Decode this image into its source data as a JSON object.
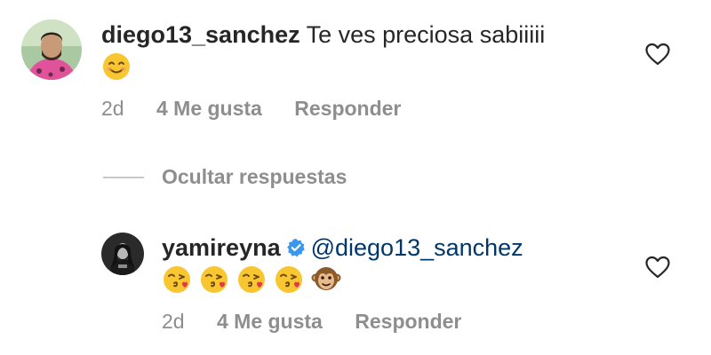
{
  "comment": {
    "username": "diego13_sanchez",
    "text": "Te ves preciosa sabiiiii",
    "emoji": "smiling-face-icon",
    "age": "2d",
    "likes": "4 Me gusta",
    "reply": "Responder"
  },
  "replies_toggle": {
    "label": "Ocultar respuestas"
  },
  "reply": {
    "username": "yamireyna",
    "verified_icon": "verified-badge-icon",
    "mention": "@diego13_sanchez",
    "emojis": [
      "kissing-face-icon",
      "kissing-face-icon",
      "kissing-face-icon",
      "kissing-face-icon",
      "monkey-face-icon"
    ],
    "age": "2d",
    "likes": "4 Me gusta",
    "reply": "Responder"
  },
  "colors": {
    "text": "#262626",
    "muted": "#8e8e8e",
    "mention": "#00376b",
    "verified": "#3897f0"
  }
}
